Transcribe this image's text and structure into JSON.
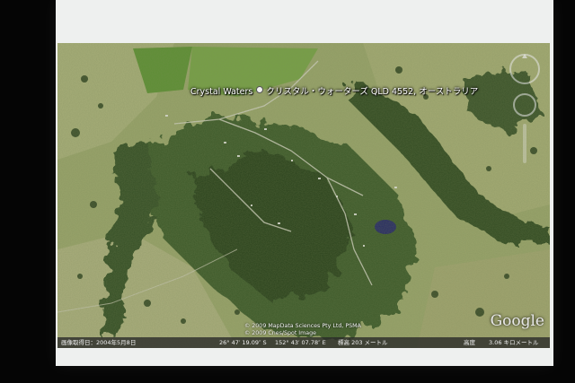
{
  "map": {
    "place_label": "Crystal Waters",
    "place_label_jp": "クリスタル・ウォーターズ QLD 4552, オーストラリア",
    "provider_logo": "Google",
    "copyright_line1": "© 2009 MapData Sciences Pty Ltd, PSMA",
    "copyright_line2": "© 2009 Cnes/Spot Image",
    "status": {
      "imagery_date": "画像取得日：2004年5月8日",
      "latitude": "26° 47′ 19.09″ S",
      "longitude": "152° 43′ 07.78″ E",
      "elevation": "標高  203 メートル",
      "eye_alt_label": "高度",
      "eye_alt_value": "3.06 キロメートル"
    }
  },
  "colors": {
    "background": "#050505",
    "screen": "#eef0ef",
    "pasture": "#9aa56c",
    "bright_field": "#6f9a3d",
    "forest": "#2f4722",
    "dam": "#2a2f66"
  },
  "icons": [
    "compass-ring-icon",
    "look-ring-icon",
    "zoom-slider-icon",
    "placemark-dot-icon"
  ]
}
